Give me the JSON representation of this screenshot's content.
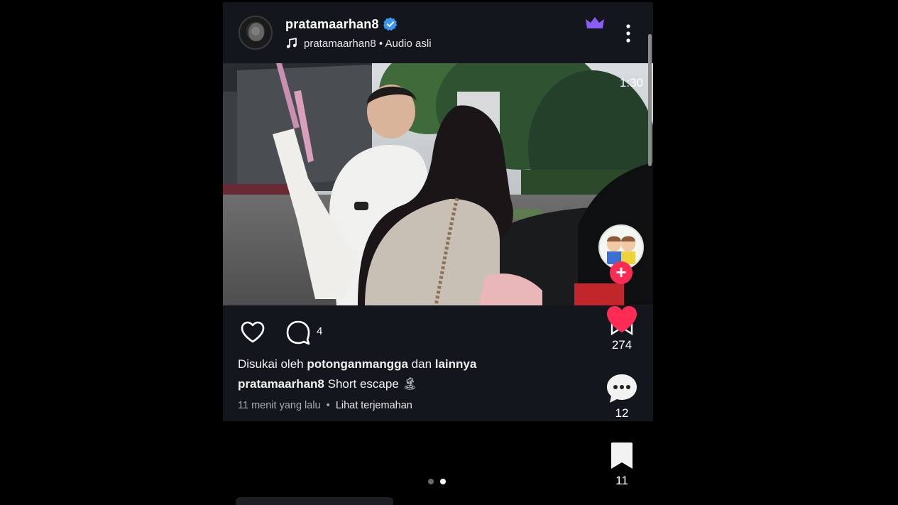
{
  "header": {
    "username": "pratamaarhan8",
    "audio_label": "pratamaarhan8 • Audio asli"
  },
  "video": {
    "duration": "1:30"
  },
  "actions": {
    "comment_count": "4"
  },
  "likes": {
    "prefix": "Disukai oleh ",
    "user": "potonganmangga",
    "suffix": " dan ",
    "others": "lainnya"
  },
  "caption": {
    "user": "pratamaarhan8",
    "text": " Short escape 🏝"
  },
  "meta": {
    "time": "11 menit yang lalu",
    "separator": "•",
    "translate": "Lihat terjemahan"
  },
  "side": {
    "like_count": "274",
    "comment_count": "12",
    "save_count": "11"
  },
  "colors": {
    "accent_red": "#fe2c55",
    "verified_blue": "#3897f0",
    "crown_purple": "#8a5cf6"
  },
  "icons": [
    "avatar",
    "verified-badge-icon",
    "music-note-icon",
    "crown-icon",
    "more-vertical-icon",
    "heart-outline-icon",
    "comment-icon",
    "heart-filled-icon",
    "bookmark-icon",
    "comment-bubble-icon",
    "plus-icon"
  ],
  "pager": {
    "pages": 2,
    "active_index": 1
  }
}
